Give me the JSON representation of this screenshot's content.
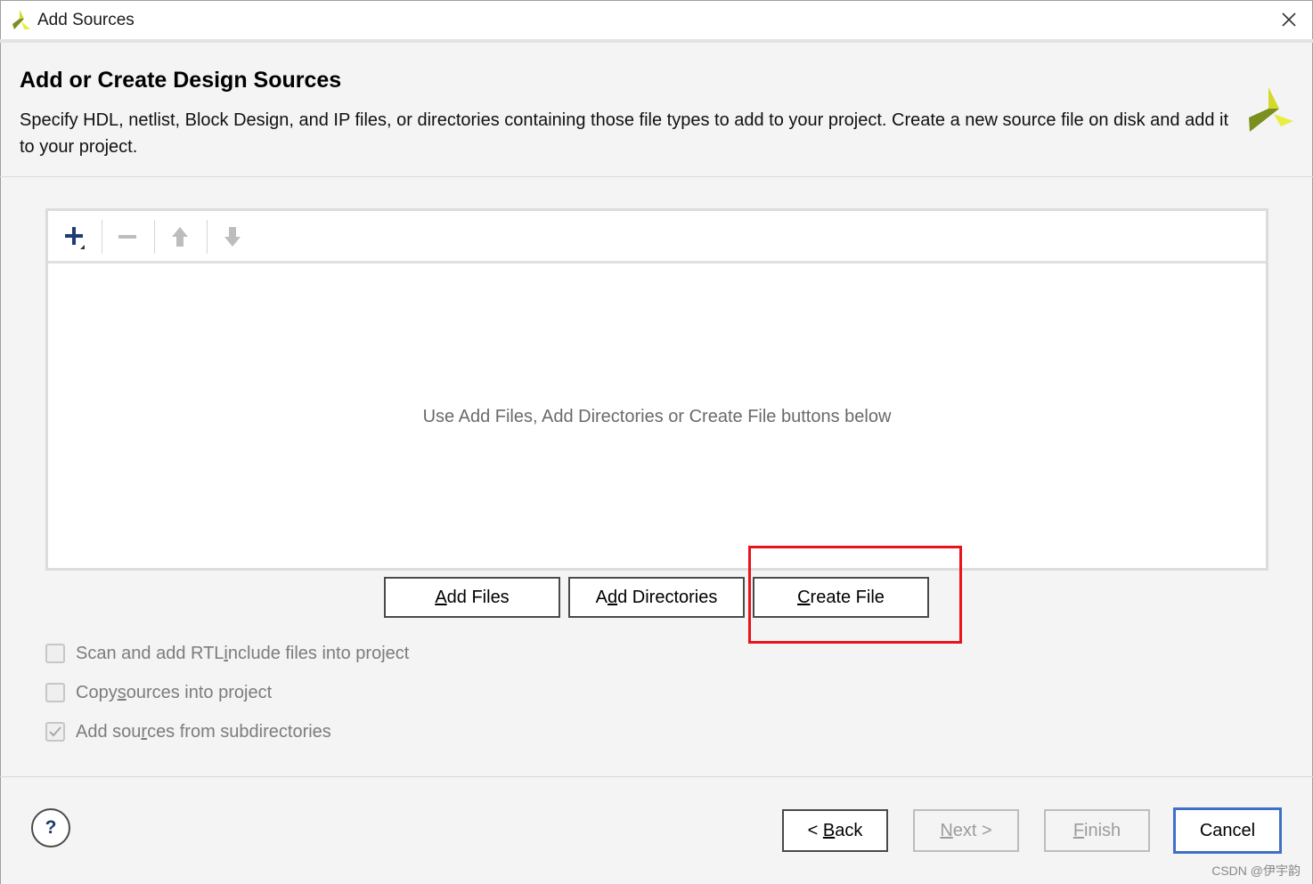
{
  "window": {
    "title": "Add Sources",
    "logo_icon": "vivado-logo-icon",
    "close_icon": "close-icon"
  },
  "header": {
    "title": "Add or Create Design Sources",
    "description": "Specify HDL, netlist, Block Design, and IP files, or directories containing those file types to add to your project. Create a new source file on disk and add it to your project.",
    "logo_icon": "vivado-logo-icon"
  },
  "toolbar": {
    "add_icon": "plus-dropdown-icon",
    "remove_icon": "minus-icon",
    "up_icon": "arrow-up-icon",
    "down_icon": "arrow-down-icon"
  },
  "file_list": {
    "empty_message": "Use Add Files, Add Directories or Create File buttons below"
  },
  "actions": {
    "add_files": {
      "pre": "",
      "key": "A",
      "post": "dd Files"
    },
    "add_directories": {
      "pre": "A",
      "key": "d",
      "post": "d Directories"
    },
    "create_file": {
      "pre": "",
      "key": "C",
      "post": "reate File"
    }
  },
  "options": {
    "scan_rtl": {
      "pre": "Scan and add RTL ",
      "key": "i",
      "post": "nclude files into project",
      "checked": false
    },
    "copy_sources": {
      "pre": "Copy ",
      "key": "s",
      "post": "ources into project",
      "checked": false
    },
    "add_subdirs": {
      "pre": "Add sou",
      "key": "r",
      "post": "ces from subdirectories",
      "checked": true
    }
  },
  "footer": {
    "help_label": "?",
    "back": {
      "pre": "< ",
      "key": "B",
      "post": "ack"
    },
    "next": {
      "pre": "",
      "key": "N",
      "post": "ext >"
    },
    "finish": {
      "pre": "",
      "key": "F",
      "post": "inish"
    },
    "cancel": "Cancel"
  },
  "watermark": "CSDN @伊宇韵",
  "colors": {
    "accent_blue": "#3f6fc6",
    "highlight_red": "#e8141c",
    "logo_green": "#7a8f1f",
    "logo_yellow": "#e6ee40"
  }
}
